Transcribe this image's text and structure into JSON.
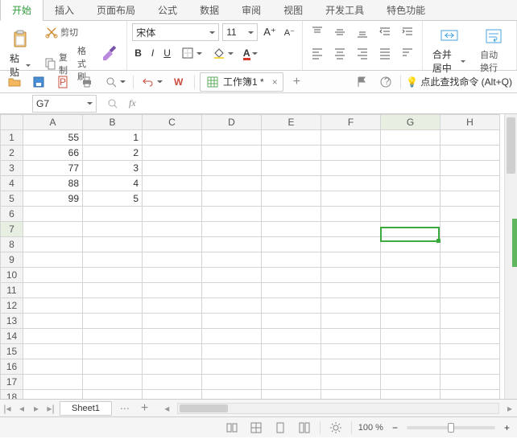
{
  "tabs": [
    "开始",
    "插入",
    "页面布局",
    "公式",
    "数据",
    "审阅",
    "视图",
    "开发工具",
    "特色功能"
  ],
  "active_tab": 0,
  "clipboard": {
    "cut": "剪切",
    "copy": "复制",
    "fmt": "格式刷",
    "paste": "粘贴"
  },
  "font": {
    "name": "宋体",
    "size": "11"
  },
  "merge": "合并居中",
  "wrap": "自动换行",
  "doc": {
    "title": "工作簿1 *"
  },
  "hint": "点此查找命令 (Alt+Q)",
  "namebox": "G7",
  "fx": "fx",
  "cols": [
    "A",
    "B",
    "C",
    "D",
    "E",
    "F",
    "G",
    "H"
  ],
  "rows": 19,
  "data": {
    "A": {
      "1": "55",
      "2": "66",
      "3": "77",
      "4": "88",
      "5": "99"
    },
    "B": {
      "1": "1",
      "2": "2",
      "3": "3",
      "4": "4",
      "5": "5"
    }
  },
  "selected": {
    "col": "G",
    "row": 7
  },
  "sheet_tab": "Sheet1",
  "zoom": "100 %"
}
